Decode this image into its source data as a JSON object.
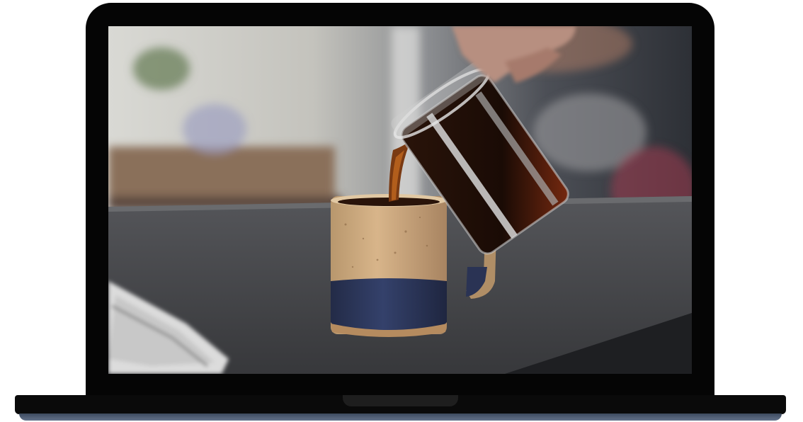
{
  "device": {
    "type": "laptop",
    "bezel_color": "#050505",
    "base_edge_color": "#52607a"
  },
  "screen_content": {
    "icon": "photo-icon",
    "colors": {
      "counter": "#3f4043",
      "mug_top": "#c9a57a",
      "mug_bottom": "#2c3658",
      "coffee": "#5a2b0e",
      "background_blur": "#b9b9b4"
    }
  }
}
